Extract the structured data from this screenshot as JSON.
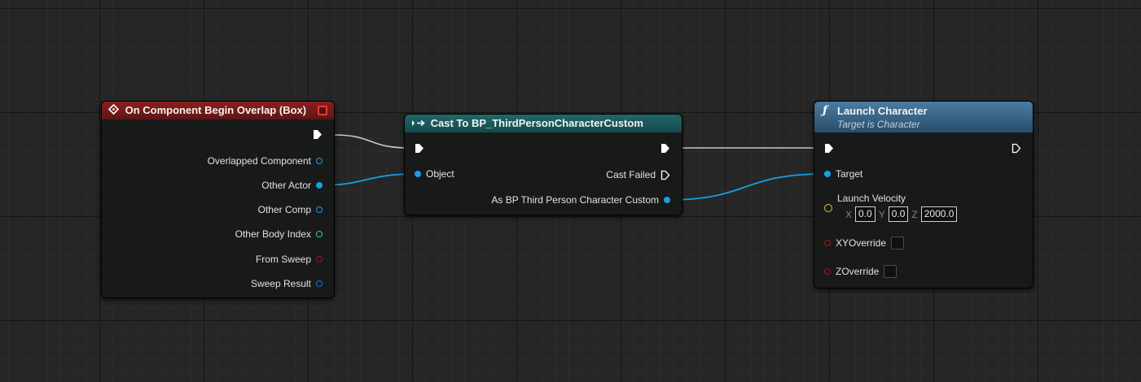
{
  "colors": {
    "event_header": "#7a1b1b",
    "cast_header": "#1d5c5e",
    "function_header": "#3d6a8e",
    "object_pin": "#1b9ee6",
    "wire_exec": "#c8c8c8"
  },
  "event_node": {
    "title": "On Component Begin Overlap (Box)",
    "icon": "event-diamond-icon",
    "outputs": [
      "Overlapped Component",
      "Other Actor",
      "Other Comp",
      "Other Body Index",
      "From Sweep",
      "Sweep Result"
    ]
  },
  "cast_node": {
    "title": "Cast To BP_ThirdPersonCharacterCustom",
    "icon": "cast-arrow-icon",
    "object_label": "Object",
    "cast_failed_label": "Cast Failed",
    "as_label": "As BP Third Person Character Custom"
  },
  "launch_node": {
    "title": "Launch Character",
    "subtitle": "Target is Character",
    "icon": "function-icon",
    "target_label": "Target",
    "velocity_label": "Launch Velocity",
    "x_axis": "X",
    "x_value": "0.0",
    "y_axis": "Y",
    "y_value": "0.0",
    "z_axis": "Z",
    "z_value": "2000.0",
    "xy_override_label": "XYOverride",
    "z_override_label": "ZOverride"
  }
}
